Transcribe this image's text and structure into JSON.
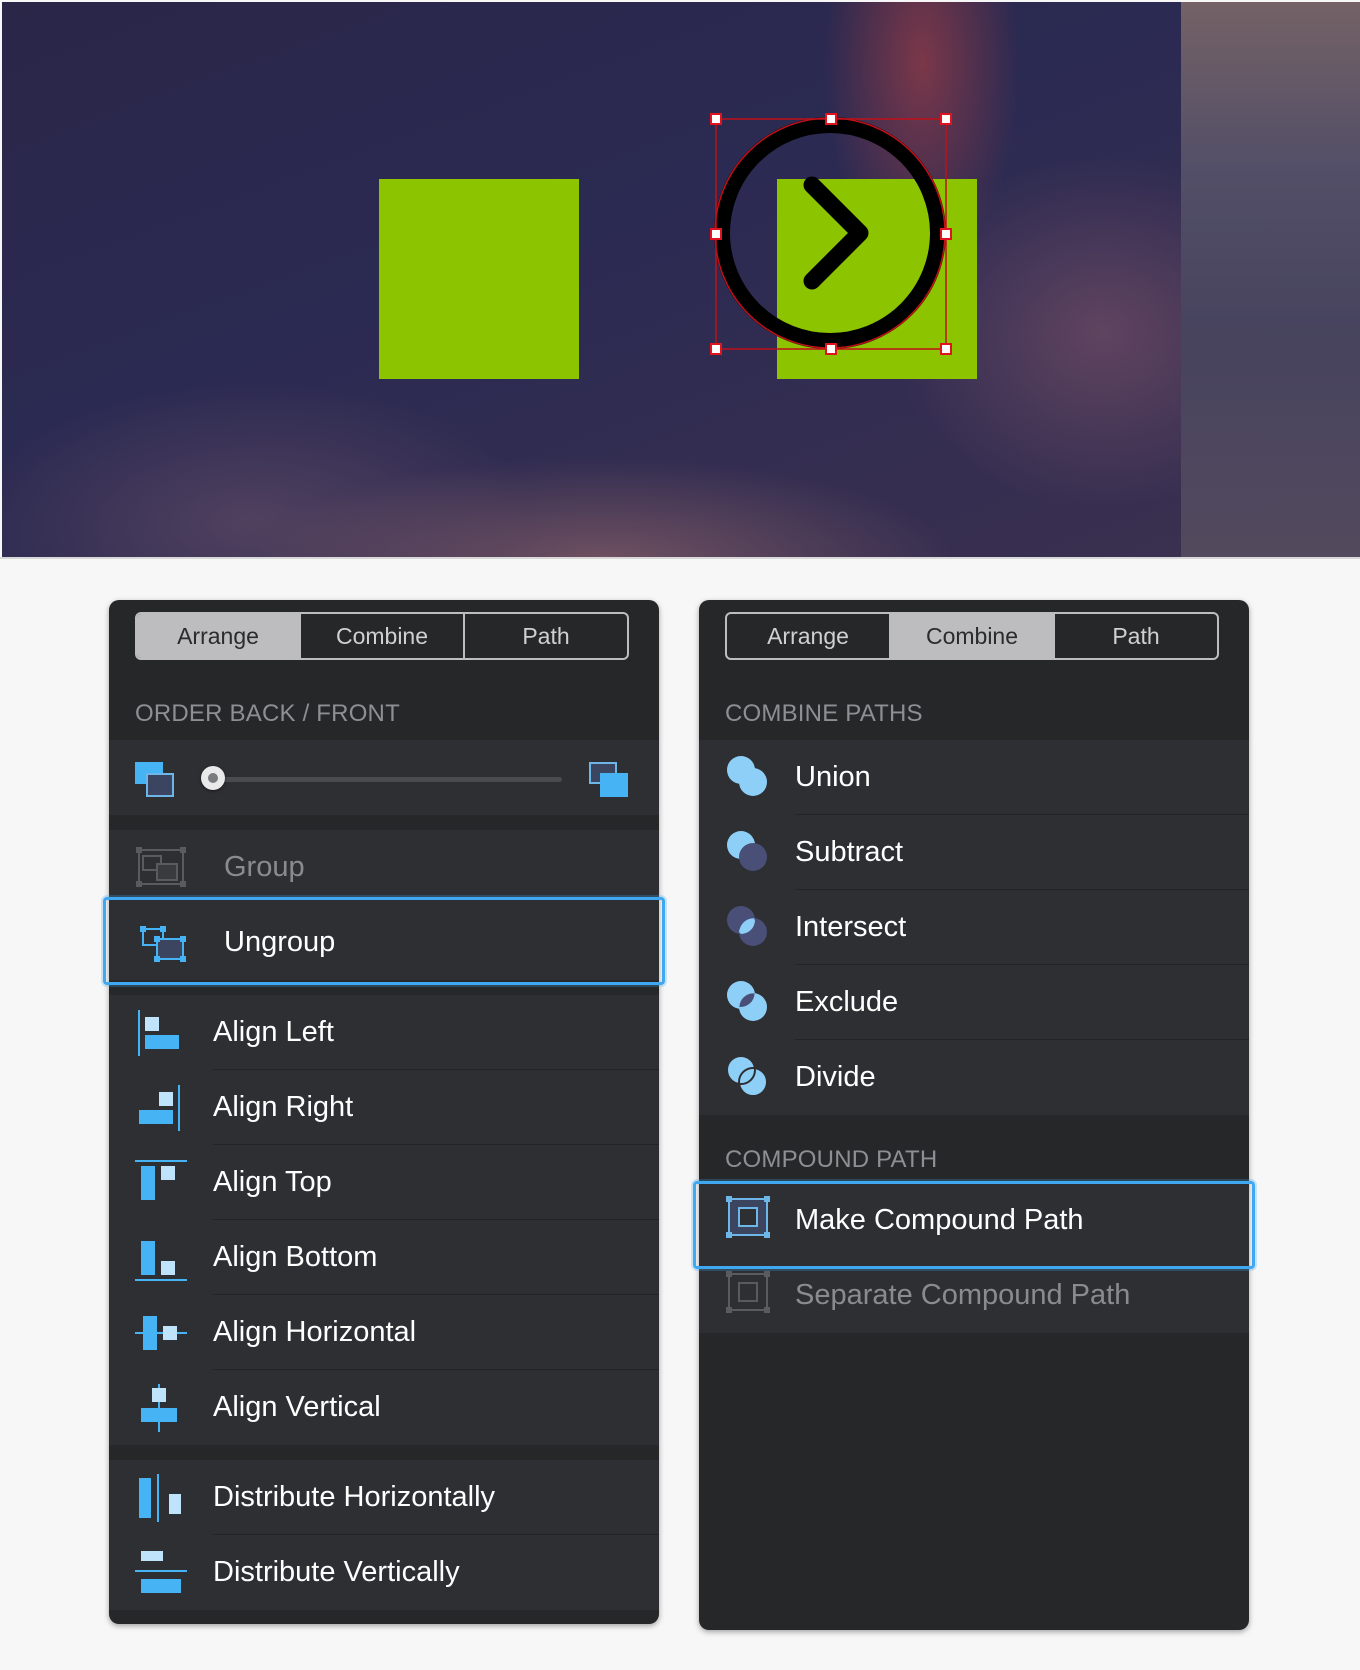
{
  "left_panel": {
    "tabs": [
      {
        "label": "Arrange",
        "active": true
      },
      {
        "label": "Combine",
        "active": false
      },
      {
        "label": "Path",
        "active": false
      }
    ],
    "order_section_title": "ORDER BACK / FRONT",
    "order_slider_value": 0,
    "group_items": [
      {
        "label": "Group",
        "enabled": false
      },
      {
        "label": "Ungroup",
        "enabled": true,
        "selected": true
      }
    ],
    "align_items": [
      {
        "label": "Align Left",
        "icon": "align-left-icon"
      },
      {
        "label": "Align Right",
        "icon": "align-right-icon"
      },
      {
        "label": "Align Top",
        "icon": "align-top-icon"
      },
      {
        "label": "Align Bottom",
        "icon": "align-bottom-icon"
      },
      {
        "label": "Align Horizontal",
        "icon": "align-horizontal-icon"
      },
      {
        "label": "Align Vertical",
        "icon": "align-vertical-icon"
      }
    ],
    "distribute_items": [
      {
        "label": "Distribute Horizontally",
        "icon": "distribute-horizontally-icon"
      },
      {
        "label": "Distribute Vertically",
        "icon": "distribute-vertically-icon"
      }
    ]
  },
  "right_panel": {
    "tabs": [
      {
        "label": "Arrange",
        "active": false
      },
      {
        "label": "Combine",
        "active": true
      },
      {
        "label": "Path",
        "active": false
      }
    ],
    "combine_section_title": "COMBINE PATHS",
    "combine_items": [
      {
        "label": "Union",
        "icon": "union-icon"
      },
      {
        "label": "Subtract",
        "icon": "subtract-icon"
      },
      {
        "label": "Intersect",
        "icon": "intersect-icon"
      },
      {
        "label": "Exclude",
        "icon": "exclude-icon"
      },
      {
        "label": "Divide",
        "icon": "divide-icon"
      }
    ],
    "compound_section_title": "COMPOUND PATH",
    "compound_items": [
      {
        "label": "Make Compound Path",
        "enabled": true,
        "selected": true
      },
      {
        "label": "Separate Compound Path",
        "enabled": false
      }
    ]
  },
  "colors": {
    "accent": "#3fa8f0",
    "icon_blue": "#46b3f5",
    "shape_green": "#8dc400",
    "selection_red": "#e0141e",
    "panel_bg": "#262729",
    "row_bg": "#2e2f33"
  }
}
